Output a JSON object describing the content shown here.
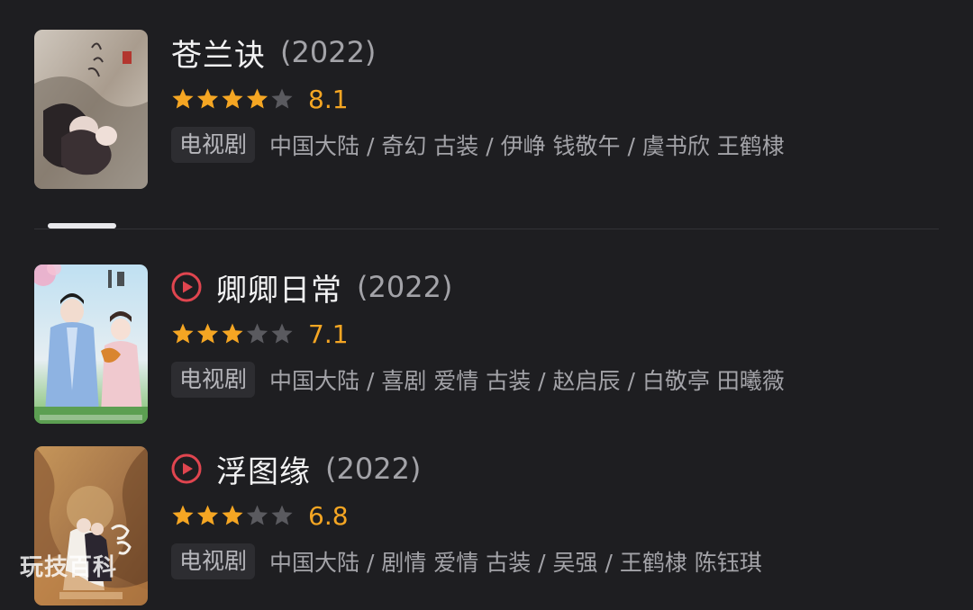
{
  "results": [
    {
      "title": "苍兰诀",
      "year": "(2022)",
      "has_play_icon": false,
      "rating": 4.0,
      "score": "8.1",
      "type": "电视剧",
      "meta": "中国大陆 / 奇幻 古装 / 伊峥 钱敬午 / 虞书欣 王鹤棣"
    },
    {
      "title": "卿卿日常",
      "year": "(2022)",
      "has_play_icon": true,
      "rating": 3.5,
      "score": "7.1",
      "type": "电视剧",
      "meta": "中国大陆 / 喜剧 爱情 古装 / 赵启辰 / 白敬亭 田曦薇"
    },
    {
      "title": "浮图缘",
      "year": "(2022)",
      "has_play_icon": true,
      "rating": 3.5,
      "score": "6.8",
      "type": "电视剧",
      "meta": "中国大陆 / 剧情 爱情 古装 / 吴强 / 王鹤棣 陈钰琪"
    }
  ],
  "watermark": "玩技百科",
  "colors": {
    "background": "#1e1e21",
    "star_filled": "#f5a623",
    "star_empty": "#5a5a5f",
    "play_icon": "#e0454f",
    "score": "#f5a623"
  }
}
